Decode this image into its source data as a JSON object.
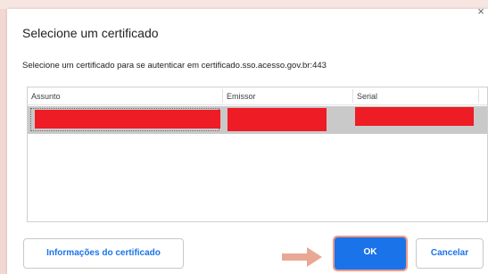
{
  "dialog": {
    "title": "Selecione um certificado",
    "close_glyph": "×",
    "subtitle": "Selecione um certificado para se autenticar em certificado.sso.acesso.gov.br:443"
  },
  "table": {
    "columns": [
      "Assunto",
      "Emissor",
      "Serial"
    ],
    "rows": [
      {
        "assunto": "",
        "emissor": "",
        "serial": "",
        "redacted": true
      }
    ]
  },
  "buttons": {
    "info_label": "Informações do certificado",
    "ok_label": "OK",
    "cancel_label": "Cancelar"
  },
  "colors": {
    "accent": "#1a73e8",
    "redaction": "#ee1c24",
    "annotation_arrow": "#e9a895",
    "selected_row": "#c9c9c9",
    "background": "#f6e5e1"
  },
  "icons": {
    "close": "close-icon",
    "arrow": "arrow-right-icon"
  }
}
